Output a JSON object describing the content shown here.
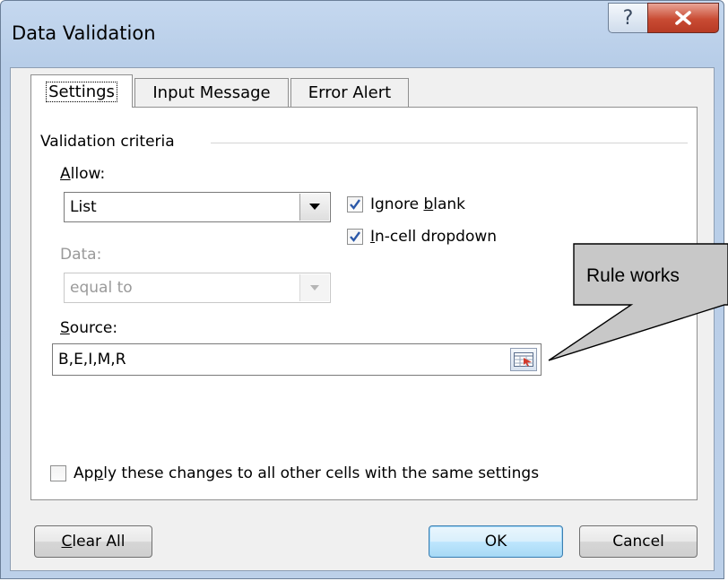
{
  "window": {
    "title": "Data Validation",
    "help_glyph": "?",
    "close_icon": "close-x-icon"
  },
  "tabs": [
    {
      "label": "Settings",
      "active": true
    },
    {
      "label": "Input Message",
      "active": false
    },
    {
      "label": "Error Alert",
      "active": false
    }
  ],
  "settings": {
    "group_label": "Validation criteria",
    "allow": {
      "label_mnemonic": "A",
      "label_rest": "llow:",
      "value": "List"
    },
    "ignore_blank": {
      "pre": "Ignore ",
      "mnemonic": "b",
      "post": "lank",
      "checked": true
    },
    "incell_dropdown": {
      "pre": "",
      "mnemonic": "I",
      "post": "n-cell dropdown",
      "checked": true
    },
    "data": {
      "label": "Data:",
      "value": "equal to",
      "disabled": true
    },
    "source": {
      "label_mnemonic": "S",
      "label_rest": "ource:",
      "value": "B,E,I,M,R"
    },
    "apply_all": {
      "pre": "Ap",
      "mnemonic": "p",
      "post": "ly these changes to all other cells with the same settings",
      "checked": false
    }
  },
  "buttons": {
    "clear_all": {
      "mnemonic": "C",
      "rest": "lear All"
    },
    "ok": "OK",
    "cancel": "Cancel"
  },
  "annotation": {
    "text": "Rule works"
  },
  "colors": {
    "title_gradient_top": "#c5d8ef",
    "close_red": "#c94b33",
    "check_blue": "#2b58a8",
    "callout_fill": "#c8c8c8"
  }
}
